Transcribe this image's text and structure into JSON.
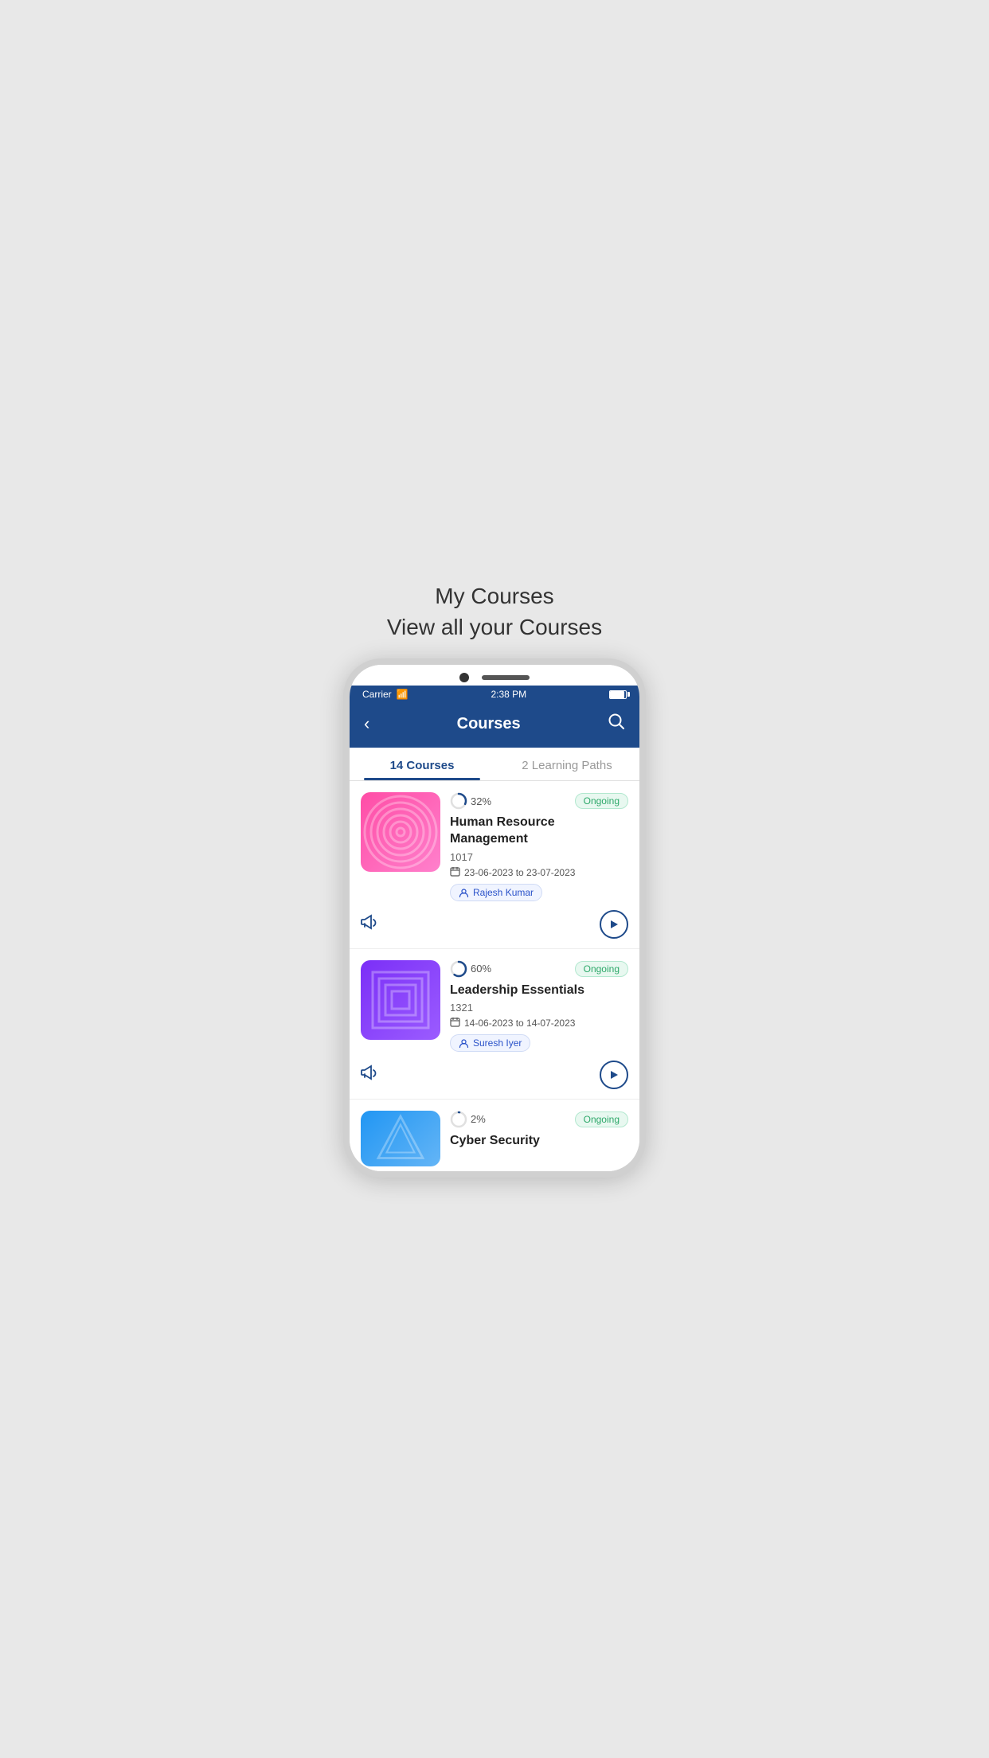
{
  "page": {
    "title_line1": "My Courses",
    "title_line2": "View all your Courses"
  },
  "status_bar": {
    "carrier": "Carrier",
    "time": "2:38 PM"
  },
  "header": {
    "back_label": "‹",
    "title": "Courses",
    "search_label": "🔍"
  },
  "tabs": [
    {
      "label": "14 Courses",
      "active": true
    },
    {
      "label": "2 Learning Paths",
      "active": false
    }
  ],
  "courses": [
    {
      "id": "hrm",
      "title": "Human Resource Management",
      "course_id": "1017",
      "progress": "32%",
      "progress_value": 32,
      "status": "Ongoing",
      "date_range": "23-06-2023 to 23-07-2023",
      "instructor": "Rajesh Kumar",
      "thumb_class": "thumb-hrm"
    },
    {
      "id": "leadership",
      "title": "Leadership Essentials",
      "course_id": "1321",
      "progress": "60%",
      "progress_value": 60,
      "status": "Ongoing",
      "date_range": "14-06-2023 to 14-07-2023",
      "instructor": "Suresh Iyer",
      "thumb_class": "thumb-leadership"
    },
    {
      "id": "cyber",
      "title": "Cyber Security",
      "progress": "2%",
      "progress_value": 2,
      "status": "Ongoing",
      "thumb_class": "thumb-cyber"
    }
  ],
  "icons": {
    "back": "‹",
    "search": "search",
    "play": "▶",
    "announce": "📢",
    "calendar": "📅",
    "user": "👤"
  }
}
